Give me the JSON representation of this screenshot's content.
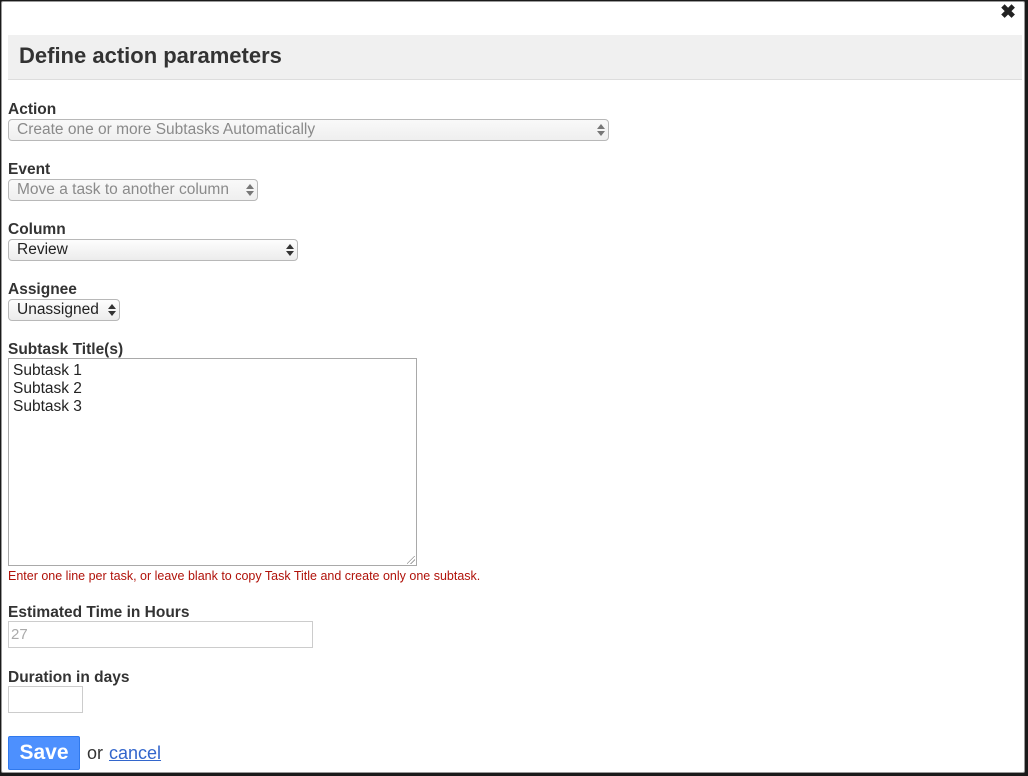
{
  "dialog": {
    "close_glyph": "✖",
    "title": "Define action parameters"
  },
  "fields": {
    "action": {
      "label": "Action",
      "value": "Create one or more Subtasks Automatically"
    },
    "event": {
      "label": "Event",
      "value": "Move a task to another column"
    },
    "column": {
      "label": "Column",
      "value": "Review"
    },
    "assignee": {
      "label": "Assignee",
      "value": "Unassigned"
    },
    "subtasks": {
      "label": "Subtask Title(s)",
      "lines": [
        "Subtask 1",
        "Subtask 2",
        "Subtask 3"
      ],
      "help": "Enter one line per task, or leave blank to copy Task Title and create only one subtask."
    },
    "estimated_time": {
      "label": "Estimated Time in Hours",
      "placeholder": "27"
    },
    "duration": {
      "label": "Duration in days",
      "value": ""
    }
  },
  "actions": {
    "save_label": "Save",
    "or_text": "or",
    "cancel_label": "cancel"
  },
  "colors": {
    "save_button": "#4d90fe",
    "help_text": "#b0120a",
    "link": "#3366cc"
  }
}
